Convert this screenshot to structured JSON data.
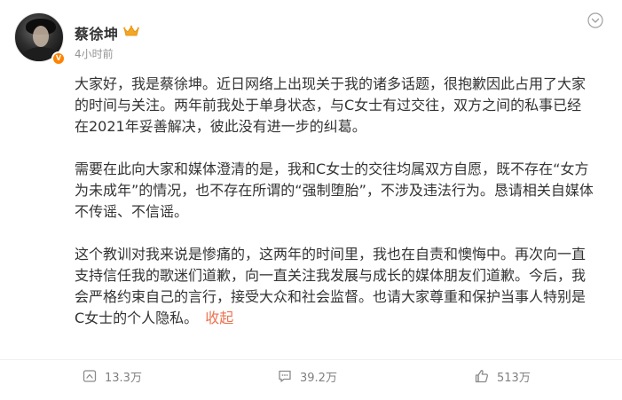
{
  "post": {
    "username": "蔡徐坤",
    "timestamp": "4小时前",
    "paragraphs": [
      {
        "lines": [
          "大家好，我是蔡徐坤。近日网络上出现关于我的诸多话题，很抱歉因此占用了大家",
          "的时间与关注。两年前我处于单身状态，与C女士有过交往，双方之间的私事已经",
          "在2021年妥善解决，彼此没有进一步的纠葛。"
        ]
      },
      {
        "lines": [
          "需要在此向大家和媒体澄清的是，我和C女士的交往均属双方自愿，既不存在“女方",
          "为未成年”的情况，也不存在所谓的“强制堕胎”，不涉及违法行为。恳请相关自媒体",
          "不传谣、不信谣。"
        ]
      },
      {
        "lines": [
          "这个教训对我来说是惨痛的，这两年的时间里，我也在自责和懊悔中。再次向一直",
          "支持信任我的歌迷们道歉，向一直关注我发展与成长的媒体朋友们道歉。今后，我",
          "会严格约束自己的言行，接受大众和社会监督。也请大家尊重和保护当事人特别是",
          "C女士的个人隐私。"
        ]
      }
    ],
    "collapse_label": "收起"
  },
  "actions": {
    "repost_count": "13.3万",
    "comment_count": "39.2万",
    "like_count": "513万"
  },
  "icons": {
    "more": "chevron-down-icon",
    "crown": "crown-badge-icon",
    "verified": "verified-badge-icon",
    "repost": "repost-icon",
    "comment": "comment-icon",
    "like": "like-icon"
  },
  "colors": {
    "link": "#eb7350",
    "verified": "#ff8200",
    "crown": "#f5a623"
  }
}
